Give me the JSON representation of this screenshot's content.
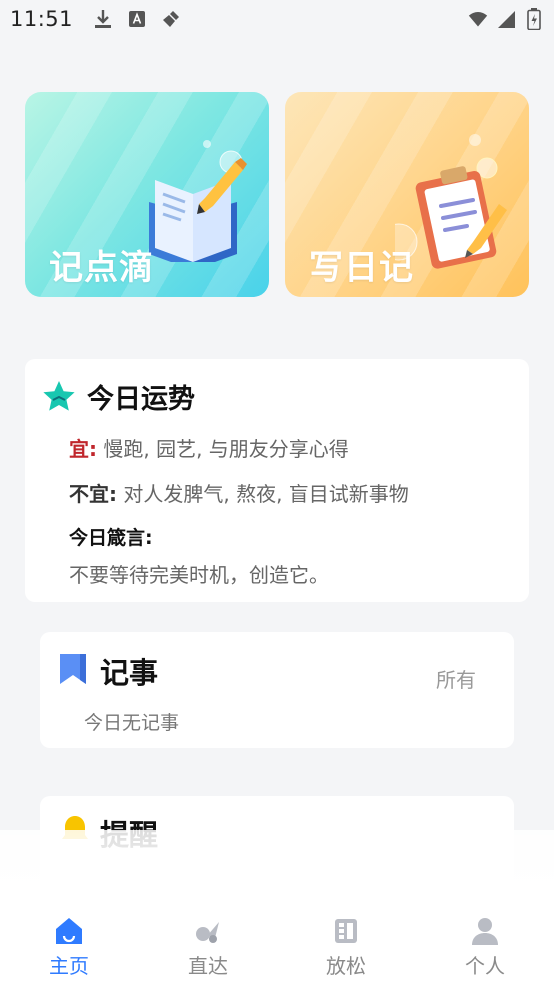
{
  "status_bar": {
    "time": "11:51"
  },
  "hero_cards": [
    {
      "title": "记点滴"
    },
    {
      "title": "写日记"
    }
  ],
  "fortune": {
    "title": "今日运势",
    "good_label": "宜:",
    "good_text": "慢跑, 园艺, 与朋友分享心得",
    "bad_label": "不宜:",
    "bad_text": "对人发脾气, 熬夜, 盲目试新事物",
    "motto_label": "今日箴言:",
    "motto_text": "不要等待完美时机，创造它。"
  },
  "memo": {
    "title": "记事",
    "all_label": "所有",
    "empty_text": "今日无记事"
  },
  "reminder": {
    "title": "提醒"
  },
  "nav": [
    {
      "label": "主页",
      "icon": "home-icon",
      "active": true
    },
    {
      "label": "直达",
      "icon": "direct-icon",
      "active": false
    },
    {
      "label": "放松",
      "icon": "relax-icon",
      "active": false
    },
    {
      "label": "个人",
      "icon": "person-icon",
      "active": false
    }
  ],
  "colors": {
    "accent": "#2f7bff",
    "good_label": "#c0262c",
    "star_teal": "#18c7b0",
    "bookmark_blue": "#5a8ff5",
    "bell_yellow": "#f8c400"
  }
}
